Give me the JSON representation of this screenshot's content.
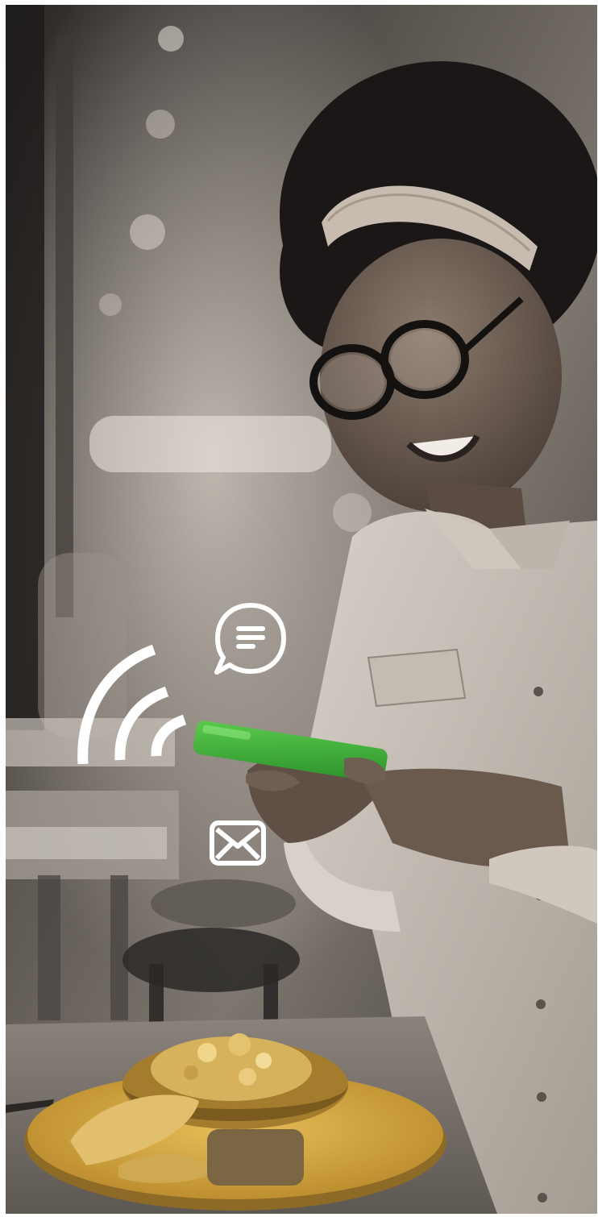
{
  "scene": {
    "subject": "",
    "tint": "sepia-monochrome",
    "accent_colors": {
      "phone": "#3cae3a",
      "plate": "#d9a93e",
      "icons": "#ffffff"
    }
  },
  "icons": {
    "chat": "chat-bubble-icon",
    "signal": "signal-waves-icon",
    "mail": "envelope-icon"
  }
}
